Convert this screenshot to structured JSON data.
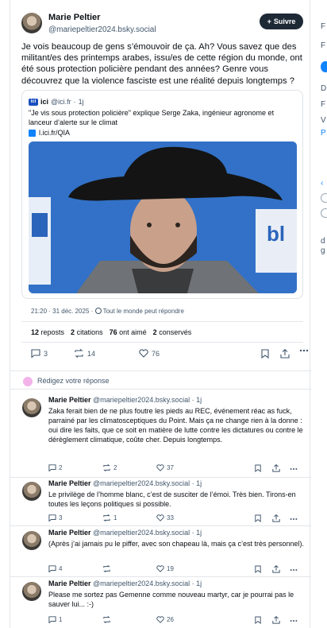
{
  "post": {
    "author_name": "Marie Peltier",
    "author_handle": "@mariepeltier2024.bsky.social",
    "follow_label": "Suivre",
    "text": "Je vois beaucoup de gens s’émouvoir de ça. Ah? Vous savez que des militant/es des printemps arabes, issu/es de cette région du monde, ont été sous protection policière pendant des années? Genre vous découvrez que la violence fasciste est une réalité depuis longtemps ?",
    "quote": {
      "source_name": "ici",
      "source_handle": "@ici.fr",
      "time": "1j",
      "text": "\"Je vis sous protection policière\" explique Serge Zaka, ingénieur agronome et lanceur d’alerte sur le climat",
      "link": "l.ici.fr/QIA"
    },
    "timestamp": "21:20 · 31 déc. 2025",
    "reply_setting": "Tout le monde peut répondre",
    "stats": {
      "reposts": "12",
      "reposts_label": "reposts",
      "citations": "2",
      "citations_label": "citations",
      "likes": "76",
      "likes_label": "ont aimé",
      "saved": "2",
      "saved_label": "conservés"
    },
    "actions": {
      "replies": "3",
      "reposts": "14",
      "likes": "76"
    }
  },
  "compose": {
    "placeholder": "Rédigez votre réponse"
  },
  "replies": [
    {
      "name": "Marie Peltier",
      "handle": "@mariepeltier2024.bsky.social",
      "time": "· 1j",
      "text": "Zaka ferait bien de ne plus foutre les pieds au REC, événement réac as fuck, parrainé par les climatosceptiques du Point. Mais ça ne change rien à la donne : oui dire les faits, que ce soit en matière de lutte contre les dictatures ou contre le dérèglement climatique, coûte cher. Depuis longtemps.",
      "replies": "2",
      "reposts": "2",
      "likes": "37"
    },
    {
      "name": "Marie Peltier",
      "handle": "@mariepeltier2024.bsky.social",
      "time": "· 1j",
      "text": "Le privilège de l’homme blanc, c’est de susciter de l’émoi. Très bien. Tirons-en toutes les leçons politiques si possible.",
      "replies": "3",
      "reposts": "1",
      "likes": "33"
    },
    {
      "name": "Marie Peltier",
      "handle": "@mariepeltier2024.bsky.social",
      "time": "· 1j",
      "text": "(Après j’ai jamais pu le piffer, avec son chapeau là, mais ça c’est très personnel).",
      "replies": "4",
      "reposts": "",
      "likes": "19"
    },
    {
      "name": "Marie Peltier",
      "handle": "@mariepeltier2024.bsky.social",
      "time": "· 1j",
      "text": "Please me sortez pas Gemenne comme nouveau martyr, car je pourrai pas le sauver lui... :-)",
      "replies": "1",
      "reposts": "",
      "likes": "26"
    }
  ],
  "sidebar": {
    "fragments": [
      "F",
      "F",
      "D",
      "F",
      "V",
      "P",
      "d",
      "g"
    ]
  },
  "colors": {
    "accent": "#1083fe",
    "follow_bg": "#1e2936",
    "muted": "#42576c",
    "like_icon": "#42576c"
  }
}
